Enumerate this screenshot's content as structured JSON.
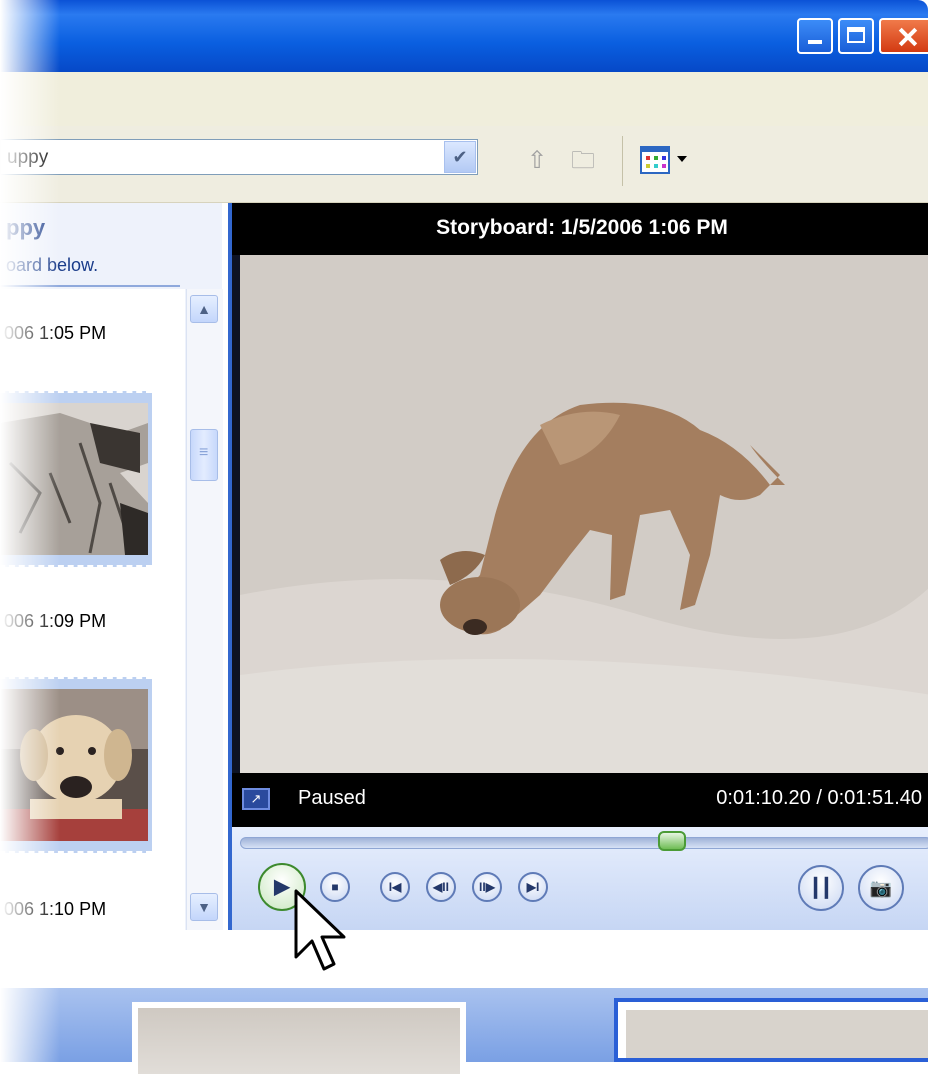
{
  "window": {
    "title_buttons": [
      "minimize",
      "maximize",
      "close"
    ]
  },
  "toolbar": {
    "collection_value": "uppy",
    "icons": [
      "up-folder-icon",
      "new-folder-icon",
      "views-icon"
    ]
  },
  "left_pane": {
    "title": "ppy",
    "subtitle": "oard below.",
    "clips": [
      {
        "label": "006 1:05 PM"
      },
      {
        "label": "006 1:09 PM"
      },
      {
        "label": "006 1:10 PM"
      }
    ]
  },
  "monitor": {
    "title": "Storyboard: 1/5/2006 1:06 PM",
    "status": "Paused",
    "time": "0:01:10.20 / 0:01:51.40",
    "progress": 0.63
  },
  "controls": {
    "play": "▶",
    "stop": "■",
    "back": "I◀",
    "prev_frame": "◀II",
    "next_frame": "II▶",
    "forward": "▶I"
  }
}
